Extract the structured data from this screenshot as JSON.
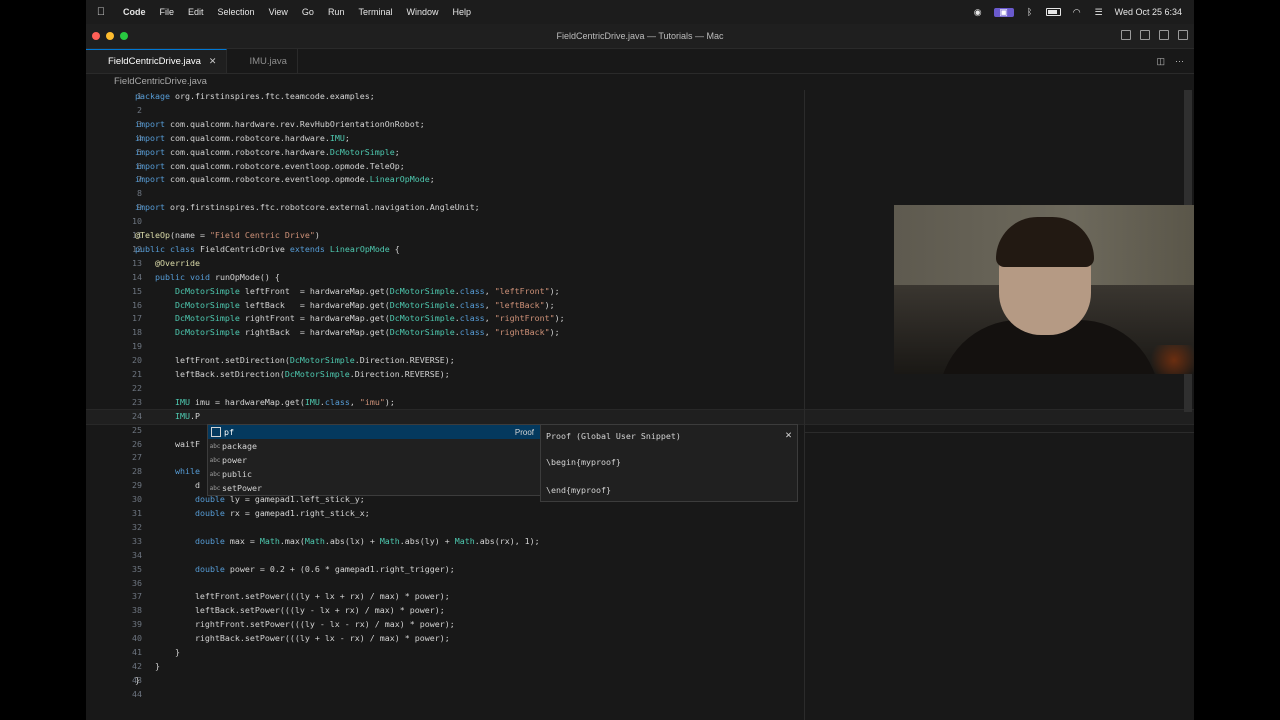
{
  "menubar": {
    "apple": "",
    "app": "Code",
    "items": [
      "File",
      "Edit",
      "Selection",
      "View",
      "Go",
      "Run",
      "Terminal",
      "Window",
      "Help"
    ],
    "clock": "Wed Oct 25  6:34"
  },
  "window": {
    "title": "FieldCentricDrive.java — Tutorials — Mac"
  },
  "tabs": [
    {
      "label": "FieldCentricDrive.java",
      "close": "✕"
    },
    {
      "label": "IMU.java"
    }
  ],
  "breadcrumb": "FieldCentricDrive.java",
  "colors": {
    "keyword": "#569cd6",
    "string": "#ce9178",
    "type": "#4ec9b0",
    "annotation": "#dcdcaa",
    "default": "#d4d4d4",
    "accent": "#0078d4"
  },
  "code": {
    "lines": [
      "package org.firstinspires.ftc.teamcode.examples;",
      "",
      "import com.qualcomm.hardware.rev.RevHubOrientationOnRobot;",
      "import com.qualcomm.robotcore.hardware.IMU;",
      "import com.qualcomm.robotcore.hardware.DcMotorSimple;",
      "import com.qualcomm.robotcore.eventloop.opmode.TeleOp;",
      "import com.qualcomm.robotcore.eventloop.opmode.LinearOpMode;",
      "",
      "import org.firstinspires.ftc.robotcore.external.navigation.AngleUnit;",
      "",
      "@TeleOp(name = \"Field Centric Drive\")",
      "public class FieldCentricDrive extends LinearOpMode {",
      "    @Override",
      "    public void runOpMode() {",
      "        DcMotorSimple leftFront  = hardwareMap.get(DcMotorSimple.class, \"leftFront\");",
      "        DcMotorSimple leftBack   = hardwareMap.get(DcMotorSimple.class, \"leftBack\");",
      "        DcMotorSimple rightFront = hardwareMap.get(DcMotorSimple.class, \"rightFront\");",
      "        DcMotorSimple rightBack  = hardwareMap.get(DcMotorSimple.class, \"rightBack\");",
      "",
      "        leftFront.setDirection(DcMotorSimple.Direction.REVERSE);",
      "        leftBack.setDirection(DcMotorSimple.Direction.REVERSE);",
      "",
      "        IMU imu = hardwareMap.get(IMU.class, \"imu\");",
      "        IMU.P",
      "",
      "        waitF",
      "",
      "        while",
      "            d",
      "            double ly = gamepad1.left_stick_y;",
      "            double rx = gamepad1.right_stick_x;",
      "",
      "            double max = Math.max(Math.abs(lx) + Math.abs(ly) + Math.abs(rx), 1);",
      "",
      "            double power = 0.2 + (0.6 * gamepad1.right_trigger);",
      "",
      "            leftFront.setPower(((ly + lx + rx) / max) * power);",
      "            leftBack.setPower(((ly - lx + rx) / max) * power);",
      "            rightFront.setPower(((ly - lx - rx) / max) * power);",
      "            rightBack.setPower(((ly + lx - rx) / max) * power);",
      "        }",
      "    }",
      "}",
      ""
    ]
  },
  "suggest": {
    "items": [
      {
        "label": "pf",
        "kind": "snippet",
        "detail": "Proof",
        "selected": true
      },
      {
        "label": "package",
        "kind": "abc"
      },
      {
        "label": "power",
        "kind": "abc"
      },
      {
        "label": "public",
        "kind": "abc"
      },
      {
        "label": "setPower",
        "kind": "abc"
      }
    ]
  },
  "doc": {
    "title": "Proof (Global User Snippet)",
    "close": "✕",
    "line1": "\\begin{myproof}",
    "line2": "\\end{myproof}"
  }
}
